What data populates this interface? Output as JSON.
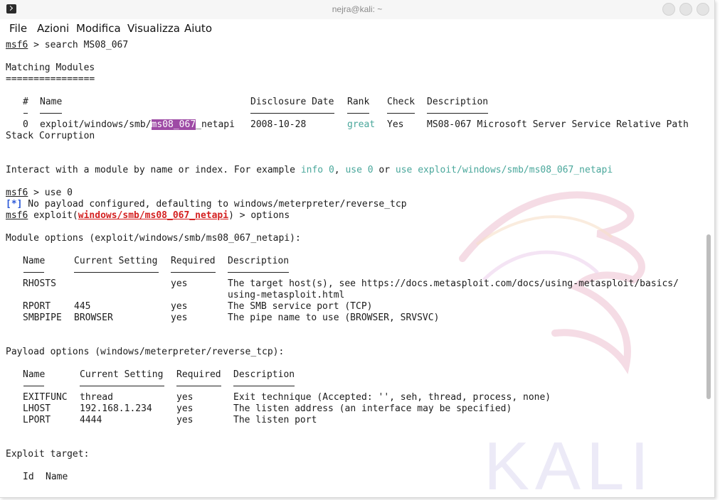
{
  "window": {
    "title": "nejra@kali: ~",
    "watermark": "KALI"
  },
  "menu": [
    "File",
    "Azioni",
    "Modifica",
    "Visualizza",
    "Aiuto"
  ],
  "terminal": {
    "prompt": "msf6",
    "cmd_search": " > search MS08_067",
    "matching_header": "Matching Modules",
    "matching_underline": "================",
    "search_cols": {
      "num": "#",
      "name": "Name",
      "date": "Disclosure Date",
      "rank": "Rank",
      "check": "Check",
      "desc": "Description"
    },
    "search_row": {
      "num": "0",
      "name_prefix": "exploit/windows/smb/",
      "name_match": "ms08_067",
      "name_suffix": "_netapi",
      "date": "2008-10-28",
      "rank": "great",
      "check": "Yes",
      "desc": "MS08-067 Microsoft Server Service Relative Path",
      "desc_cont": "Stack Corruption"
    },
    "interact_text": "Interact with a module by name or index. For example ",
    "interact_info": "info 0",
    "interact_comma": ", ",
    "interact_use": "use 0",
    "interact_or": " or ",
    "interact_use_full": "use exploit/windows/smb/ms08_067_netapi",
    "cmd_use": " > use 0",
    "info_marker": "[*]",
    "info_msg": " No payload configured, defaulting to windows/meterpreter/reverse_tcp",
    "exploit_prefix": " exploit(",
    "exploit_module": "windows/smb/ms08_067_netapi",
    "exploit_cmd": ") > options",
    "module_options_header": "Module options (exploit/windows/smb/ms08_067_netapi):",
    "mod_cols": {
      "name": "Name",
      "setting": "Current Setting",
      "required": "Required",
      "desc": "Description"
    },
    "mod_rows": [
      {
        "name": "RHOSTS",
        "setting": "",
        "required": "yes",
        "desc": "The target host(s), see https://docs.metasploit.com/docs/using-metasploit/basics/",
        "desc2": "using-metasploit.html"
      },
      {
        "name": "RPORT",
        "setting": "445",
        "required": "yes",
        "desc": "The SMB service port (TCP)"
      },
      {
        "name": "SMBPIPE",
        "setting": "BROWSER",
        "required": "yes",
        "desc": "The pipe name to use (BROWSER, SRVSVC)"
      }
    ],
    "payload_options_header": "Payload options (windows/meterpreter/reverse_tcp):",
    "pay_cols": {
      "name": "Name",
      "setting": "Current Setting",
      "required": "Required",
      "desc": "Description"
    },
    "pay_rows": [
      {
        "name": "EXITFUNC",
        "setting": "thread",
        "required": "yes",
        "desc": "Exit technique (Accepted: '', seh, thread, process, none)"
      },
      {
        "name": "LHOST",
        "setting": "192.168.1.234",
        "required": "yes",
        "desc": "The listen address (an interface may be specified)"
      },
      {
        "name": "LPORT",
        "setting": "4444",
        "required": "yes",
        "desc": "The listen port"
      }
    ],
    "exploit_target_header": "Exploit target:",
    "target_cols": {
      "id": "Id",
      "name": "Name"
    }
  },
  "colors": {
    "accent_cyan": "#49a79b",
    "info_blue": "#2c59d8",
    "module_red": "#d42020",
    "search_highlight": "#9e4aa5"
  }
}
